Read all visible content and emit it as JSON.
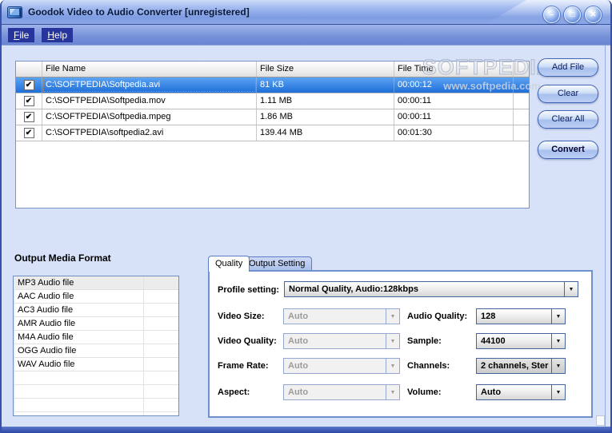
{
  "window": {
    "title": "Goodok Video to Audio Converter  [unregistered]",
    "controls": {
      "minimize": "–",
      "maximize": "□",
      "close": "✕"
    }
  },
  "menu": {
    "file": {
      "key": "F",
      "rest": "ile"
    },
    "help": {
      "key": "H",
      "rest": "elp"
    }
  },
  "file_table": {
    "columns": {
      "name": "File Name",
      "size": "File Size",
      "time": "File Time"
    },
    "rows": [
      {
        "checked": true,
        "selected": true,
        "name": "C:\\SOFTPEDIA\\Softpedia.avi",
        "size": "81 KB",
        "time": "00:00:12"
      },
      {
        "checked": true,
        "selected": false,
        "name": "C:\\SOFTPEDIA\\Softpedia.mov",
        "size": "1.11 MB",
        "time": "00:00:11"
      },
      {
        "checked": true,
        "selected": false,
        "name": "C:\\SOFTPEDIA\\Softpedia.mpeg",
        "size": "1.86 MB",
        "time": "00:00:11"
      },
      {
        "checked": true,
        "selected": false,
        "name": "C:\\SOFTPEDIA\\softpedia2.avi",
        "size": "139.44 MB",
        "time": "00:01:30"
      }
    ]
  },
  "watermark": {
    "title": "SOFTPEDIA",
    "tm": "™",
    "url": "www.softpedia.com"
  },
  "action_buttons": {
    "add_file": "Add File",
    "clear": "Clear",
    "clear_all": "Clear All",
    "convert": "Convert"
  },
  "output_format": {
    "label": "Output Media Format",
    "items": [
      "MP3 Audio file",
      "AAC Audio file",
      "AC3 Audio file",
      "AMR Audio file",
      "M4A Audio file",
      "OGG Audio file",
      "WAV Audio file"
    ],
    "selected": "MP3 Audio file"
  },
  "tabs": {
    "quality": "Quality",
    "output_setting": "Output Setting",
    "active": "Quality"
  },
  "quality_panel": {
    "profile_label": "Profile setting:",
    "profile_value": "Normal Quality, Audio:128kbps",
    "video_size": {
      "label": "Video Size:",
      "value": "Auto",
      "disabled": true
    },
    "video_quality": {
      "label": "Video Quality:",
      "value": "Auto",
      "disabled": true
    },
    "frame_rate": {
      "label": "Frame Rate:",
      "value": "Auto",
      "disabled": true
    },
    "aspect": {
      "label": "Aspect:",
      "value": "Auto",
      "disabled": true
    },
    "audio_quality": {
      "label": "Audio Quality:",
      "value": "128"
    },
    "sample": {
      "label": "Sample:",
      "value": "44100"
    },
    "channels": {
      "label": "Channels:",
      "value": "2 channels, Ster"
    },
    "volume": {
      "label": "Volume:",
      "value": "Auto"
    }
  },
  "icons": {
    "check": "✔",
    "dropdown": "▼"
  },
  "colors": {
    "selection_blue": "#2f80e4",
    "titlebar_blue": "#7e9ce2",
    "menu_item_navy": "#26349c",
    "button_border": "#3c64b8",
    "panel_border": "#6e90cc",
    "watermark_gray": "#c3cbd9"
  }
}
